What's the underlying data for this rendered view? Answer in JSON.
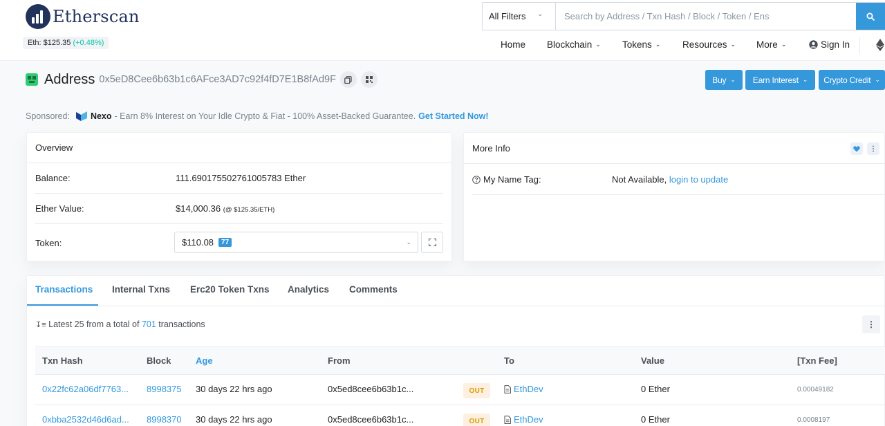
{
  "header": {
    "logo_text": "Etherscan",
    "eth_price_label": "Eth: $125.35",
    "eth_price_change": "(+0.48%)",
    "filter_label": "All Filters",
    "search_placeholder": "Search by Address / Txn Hash / Block / Token / Ens",
    "nav": {
      "home": "Home",
      "blockchain": "Blockchain",
      "tokens": "Tokens",
      "resources": "Resources",
      "more": "More",
      "sign_in": "Sign In"
    }
  },
  "address": {
    "title": "Address",
    "hash": "0x5eD8Cee6b63b1c6AFce3AD7c92f4fD7E1B8fAd9F",
    "buttons": {
      "buy": "Buy",
      "earn_interest": "Earn Interest",
      "crypto_credit": "Crypto Credit"
    }
  },
  "sponsored": {
    "label": "Sponsored:",
    "brand": "Nexo",
    "text": "- Earn 8% Interest on Your Idle Crypto & Fiat - 100% Asset-Backed Guarantee.",
    "cta": "Get Started Now!"
  },
  "overview": {
    "title": "Overview",
    "balance_label": "Balance:",
    "balance_value": "111.690175502761005783 Ether",
    "ether_value_label": "Ether Value:",
    "ether_value": "$14,000.36",
    "ether_value_rate": "(@ $125.35/ETH)",
    "token_label": "Token:",
    "token_value": "$110.08",
    "token_count": "77"
  },
  "more_info": {
    "title": "More Info",
    "name_tag_label": "My Name Tag:",
    "name_tag_value": "Not Available,",
    "name_tag_link": "login to update"
  },
  "tabs": [
    "Transactions",
    "Internal Txns",
    "Erc20 Token Txns",
    "Analytics",
    "Comments"
  ],
  "tx_summary": {
    "prefix": "Latest 25 from a total of",
    "count": "701",
    "suffix": "transactions"
  },
  "table": {
    "headers": {
      "hash": "Txn Hash",
      "block": "Block",
      "age": "Age",
      "from": "From",
      "to": "To",
      "value": "Value",
      "fee": "[Txn Fee]"
    },
    "rows": [
      {
        "hash": "0x22fc62a06df7763...",
        "block": "8998375",
        "age": "30 days 22 hrs ago",
        "from": "0x5ed8cee6b63b1c...",
        "direction": "OUT",
        "to": "EthDev",
        "value": "0 Ether",
        "fee": "0.00049182"
      },
      {
        "hash": "0xbba2532d46d6ad...",
        "block": "8998370",
        "age": "30 days 22 hrs ago",
        "from": "0x5ed8cee6b63b1c...",
        "direction": "OUT",
        "to": "EthDev",
        "value": "0 Ether",
        "fee": "0.0008197"
      }
    ]
  },
  "colors": {
    "primary": "#3498db",
    "brand_dark": "#21325b",
    "positive": "#00c9a7",
    "out_badge_bg": "#fdf0e1",
    "out_badge_text": "#db9a04"
  }
}
